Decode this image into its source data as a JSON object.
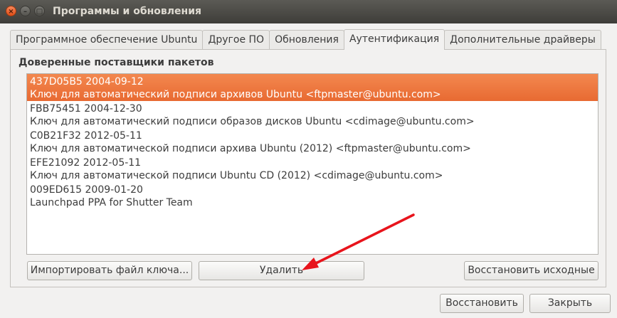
{
  "window": {
    "title": "Программы и обновления",
    "controls": {
      "close": "×",
      "minimize": "–",
      "maximize": "□"
    }
  },
  "tabs": [
    {
      "label": "Программное обеспечение Ubuntu"
    },
    {
      "label": "Другое ПО"
    },
    {
      "label": "Обновления"
    },
    {
      "label": "Аутентификация"
    },
    {
      "label": "Дополнительные драйверы"
    }
  ],
  "active_tab": 3,
  "section": {
    "label": "Доверенные поставщики пакетов"
  },
  "keys": [
    {
      "id_date": "437D05B5 2004-09-12",
      "description": "Ключ для автоматический подписи архивов Ubuntu <ftpmaster@ubuntu.com>"
    },
    {
      "id_date": "FBB75451 2004-12-30",
      "description": "Ключ для автоматический подписи образов дисков Ubuntu <cdimage@ubuntu.com>"
    },
    {
      "id_date": "C0B21F32 2012-05-11",
      "description": "Ключ для автоматической подписи архива Ubuntu (2012) <ftpmaster@ubuntu.com>"
    },
    {
      "id_date": "EFE21092 2012-05-11",
      "description": "Ключ для автоматической подписи Ubuntu CD (2012) <cdimage@ubuntu.com>"
    },
    {
      "id_date": "009ED615 2009-01-20",
      "description": "Launchpad PPA for Shutter Team"
    }
  ],
  "selected_key": 0,
  "buttons": {
    "import": "Импортировать файл ключа...",
    "remove": "Удалить",
    "restore_defaults": "Восстановить исходные",
    "revert": "Восстановить",
    "close": "Закрыть"
  },
  "colors": {
    "selection": "#e9703a",
    "annotation_arrow": "#e8141c",
    "titlebar": "#3e3d39"
  }
}
